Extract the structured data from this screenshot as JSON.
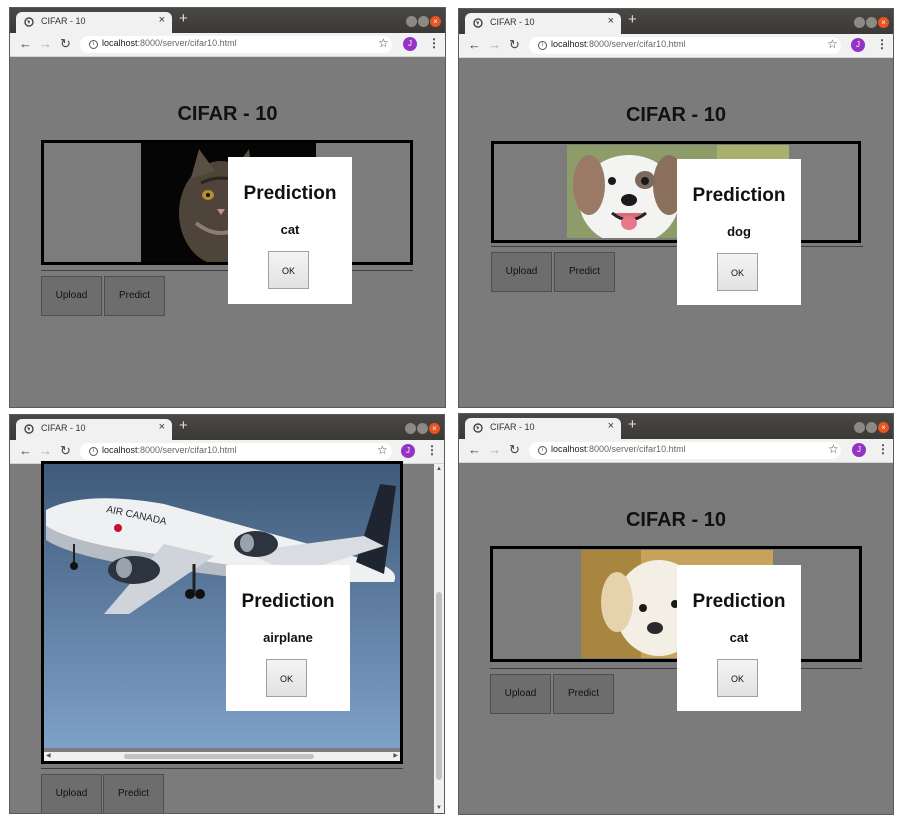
{
  "windows": [
    {
      "tab_title": "CIFAR - 10",
      "url_host": "localhost",
      "url_path": ":8000/server/cifar10.html",
      "avatar_letter": "J",
      "page_title": "CIFAR - 10",
      "image_subject": "cat",
      "upload_label": "Upload",
      "predict_label": "Predict",
      "modal": {
        "heading": "Prediction",
        "value": "cat",
        "ok_label": "OK"
      }
    },
    {
      "tab_title": "CIFAR - 10",
      "url_host": "localhost",
      "url_path": ":8000/server/cifar10.html",
      "avatar_letter": "J",
      "page_title": "CIFAR - 10",
      "image_subject": "dog",
      "upload_label": "Upload",
      "predict_label": "Predict",
      "modal": {
        "heading": "Prediction",
        "value": "dog",
        "ok_label": "OK"
      }
    },
    {
      "tab_title": "CIFAR - 10",
      "url_host": "localhost",
      "url_path": ":8000/server/cifar10.html",
      "avatar_letter": "J",
      "image_subject": "airplane",
      "upload_label": "Upload",
      "predict_label": "Predict",
      "modal": {
        "heading": "Prediction",
        "value": "airplane",
        "ok_label": "OK"
      }
    },
    {
      "tab_title": "CIFAR - 10",
      "url_host": "localhost",
      "url_path": ":8000/server/cifar10.html",
      "avatar_letter": "J",
      "page_title": "CIFAR - 10",
      "image_subject": "puppy",
      "upload_label": "Upload",
      "predict_label": "Predict",
      "modal": {
        "heading": "Prediction",
        "value": "cat",
        "ok_label": "OK"
      }
    }
  ],
  "icons": {
    "tab_favicon": "globe-icon",
    "tab_close": "close-icon",
    "new_tab": "plus-icon",
    "back": "back-arrow-icon",
    "forward": "forward-arrow-icon",
    "reload": "reload-icon",
    "site_info": "info-icon",
    "bookmark": "star-icon",
    "menu": "kebab-menu-icon",
    "window_close": "window-close-icon"
  },
  "colors": {
    "page_dimmed_background": "#7b7b7b",
    "titlebar": "#3b3935",
    "window_close": "#e95420",
    "avatar": "#9334c6"
  }
}
